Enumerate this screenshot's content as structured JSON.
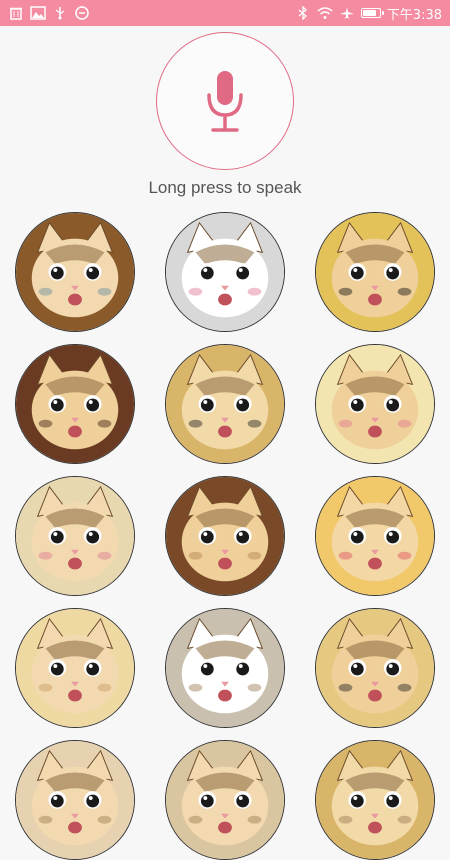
{
  "status_bar": {
    "time": "下午3:38",
    "left_icons": [
      "trash-icon",
      "image-icon",
      "usb-icon",
      "smiley-icon"
    ],
    "right_icons": [
      "bluetooth-icon",
      "wifi-icon",
      "airplane-icon",
      "battery-icon"
    ],
    "battery_level": 0.9,
    "background": "#f48ba0"
  },
  "voice": {
    "mic_icon": "microphone-icon",
    "accent_color": "#e06a84",
    "hint": "Long press to speak"
  },
  "stickers": [
    {
      "name": "cat-sticker-1",
      "bg": "#8a5a2a",
      "cat": "#f2d9b0",
      "overlay": "#6b8fa0"
    },
    {
      "name": "cat-sticker-2",
      "bg": "#d8d8d8",
      "cat": "#ffffff",
      "overlay": "#e07890"
    },
    {
      "name": "cat-sticker-3",
      "bg": "#e3c25a",
      "cat": "#f0d09a",
      "overlay": "#111111"
    },
    {
      "name": "cat-sticker-4",
      "bg": "#6a3a22",
      "cat": "#f0d09a",
      "overlay": "#3a1a10"
    },
    {
      "name": "cat-sticker-5",
      "bg": "#d9b56a",
      "cat": "#f2d9a8",
      "overlay": "#222222"
    },
    {
      "name": "cat-sticker-6",
      "bg": "#f3e5b0",
      "cat": "#f0d09a",
      "overlay": "#e07890"
    },
    {
      "name": "cat-sticker-7",
      "bg": "#e8d8b0",
      "cat": "#f2d9b0",
      "overlay": "#e07890"
    },
    {
      "name": "cat-sticker-8",
      "bg": "#7a4a28",
      "cat": "#f0d09a",
      "overlay": "#b08050"
    },
    {
      "name": "cat-sticker-9",
      "bg": "#f1c86a",
      "cat": "#f3d7a5",
      "overlay": "#e05060"
    },
    {
      "name": "cat-sticker-10",
      "bg": "#efd9a3",
      "cat": "#f2d9b0",
      "overlay": "#c89a60"
    },
    {
      "name": "cat-sticker-11",
      "bg": "#c9c0b0",
      "cat": "#ffffff",
      "overlay": "#9a7a50"
    },
    {
      "name": "cat-sticker-12",
      "bg": "#e6c981",
      "cat": "#f0d09a",
      "overlay": "#222222"
    },
    {
      "name": "cat-sticker-13",
      "bg": "#e6d2b0",
      "cat": "#f2d9b0",
      "overlay": "#9a7a50"
    },
    {
      "name": "cat-sticker-14",
      "bg": "#d9c6a0",
      "cat": "#f2d9b0",
      "overlay": "#9a7a50"
    },
    {
      "name": "cat-sticker-15",
      "bg": "#d9b56a",
      "cat": "#f2d9a8",
      "overlay": "#9a7a50"
    }
  ]
}
